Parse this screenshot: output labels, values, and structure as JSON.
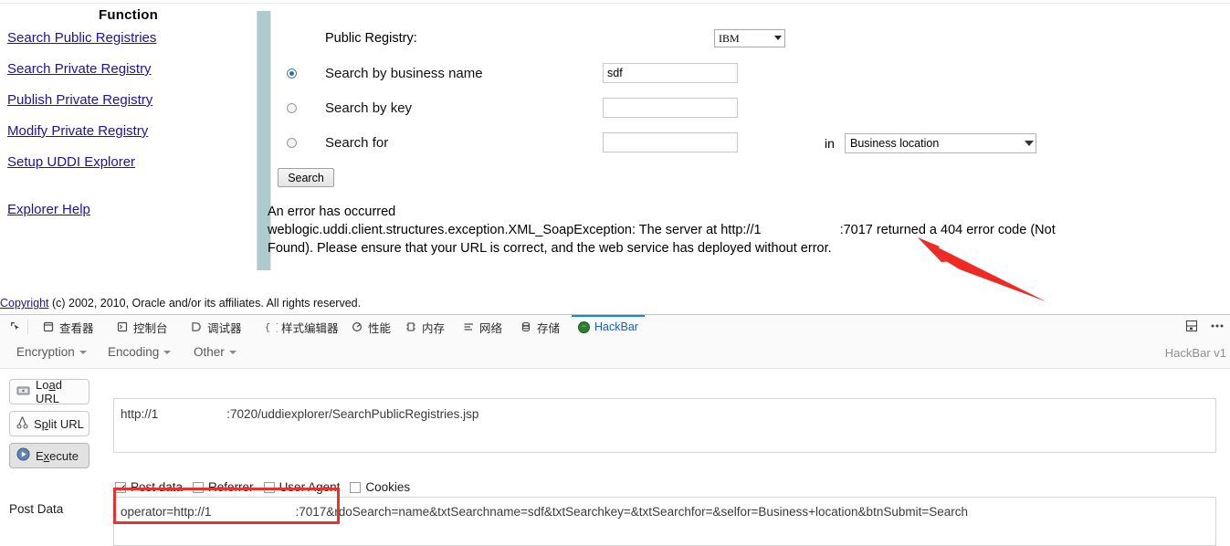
{
  "sidebar": {
    "title": "Function",
    "items": [
      {
        "label": "Search Public Registries"
      },
      {
        "label": "Search Private Registry"
      },
      {
        "label": "Publish Private Registry"
      },
      {
        "label": "Modify Private Registry"
      },
      {
        "label": "Setup UDDI Explorer"
      }
    ],
    "help_label": "Explorer Help"
  },
  "form": {
    "registry_label": "Public Registry:",
    "registry_value": "IBM",
    "options": [
      {
        "label": "Search by business name",
        "value": "sdf",
        "selected": true
      },
      {
        "label": "Search by key",
        "value": "",
        "selected": false
      },
      {
        "label": "Search for",
        "value": "",
        "selected": false
      }
    ],
    "in_label": "in",
    "selfor_value": "Business location",
    "search_button": "Search"
  },
  "error": {
    "line1": "An error has occurred",
    "line2_a": "weblogic.uddi.client.structures.exception.XML_SoapException: The server at http://1",
    "line2_b": ":7017 returned a 404 error code (Not",
    "line3": "Found). Please ensure that your URL is correct, and the web service has deployed without error."
  },
  "footer": {
    "copyright_link": "Copyright",
    "copyright_text": " (c) 2002, 2010, Oracle and/or its affiliates. All rights reserved."
  },
  "devtools": {
    "tabs": [
      {
        "label": "查看器",
        "icon": "inspector-icon",
        "active": false
      },
      {
        "label": "控制台",
        "icon": "console-icon",
        "active": false
      },
      {
        "label": "调试器",
        "icon": "debugger-icon",
        "active": false
      },
      {
        "label": "样式编辑器",
        "icon": "style-editor-icon",
        "active": false
      },
      {
        "label": "性能",
        "icon": "performance-icon",
        "active": false
      },
      {
        "label": "内存",
        "icon": "memory-icon",
        "active": false
      },
      {
        "label": "网络",
        "icon": "network-icon",
        "active": false
      },
      {
        "label": "存储",
        "icon": "storage-icon",
        "active": false
      },
      {
        "label": "HackBar",
        "icon": "hackbar-icon",
        "active": true
      }
    ],
    "picker_icon": "element-picker-icon",
    "dock_icon": "dock-position-icon",
    "more_icon": "more-options-icon"
  },
  "hackbar": {
    "menus": [
      {
        "label": "Encryption"
      },
      {
        "label": "Encoding"
      },
      {
        "label": "Other"
      }
    ],
    "version": "HackBar v1",
    "buttons": [
      {
        "label": "Load URL",
        "accel": "a",
        "icon": "load-url-icon",
        "pressed": false
      },
      {
        "label": "Split URL",
        "accel": "p",
        "icon": "split-url-icon",
        "pressed": false
      },
      {
        "label": "Execute",
        "accel": "x",
        "icon": "execute-icon",
        "pressed": true
      }
    ],
    "url_prefix": "http://1",
    "url_suffix": ":7020/uddiexplorer/SearchPublicRegistries.jsp",
    "checkboxes": [
      {
        "label": "Post data",
        "checked": true
      },
      {
        "label": "Referrer",
        "checked": false
      },
      {
        "label": "User Agent",
        "checked": false
      },
      {
        "label": "Cookies",
        "checked": false
      }
    ],
    "postdata_label": "Post Data",
    "postdata_prefix": "operator=http://1",
    "postdata_suffix": ":7017&rdoSearch=name&txtSearchname=sdf&txtSearchkey=&txtSearchfor=&selfor=Business+location&btnSubmit=Search"
  },
  "annotation": {
    "arrow_color": "#ee2a24",
    "highlight_color": "#e8322e"
  }
}
